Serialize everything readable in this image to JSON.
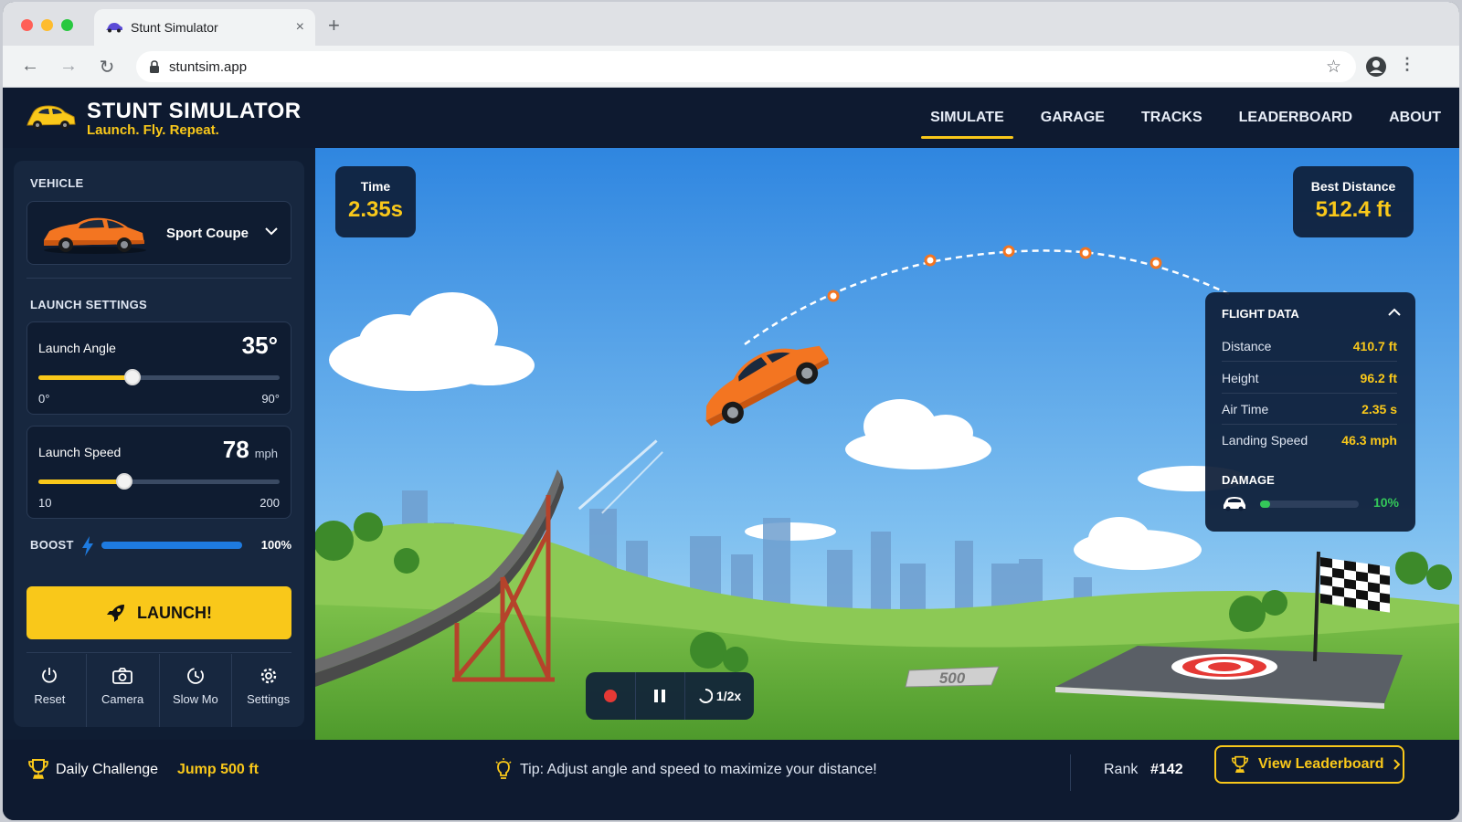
{
  "browser": {
    "tab_title": "Stunt Simulator",
    "tab_close": "×",
    "new_tab": "+",
    "url": "stuntsim.app"
  },
  "app": {
    "title": "STUNT SIMULATOR",
    "tagline": "Launch. Fly. Repeat.",
    "nav": [
      "SIMULATE",
      "GARAGE",
      "TRACKS",
      "LEADERBOARD",
      "ABOUT"
    ],
    "active_nav": "SIMULATE"
  },
  "sidebar": {
    "vehicle_label": "VEHICLE",
    "vehicle_name": "Sport Coupe",
    "launch_settings_label": "LAUNCH SETTINGS",
    "angle": {
      "label": "Launch Angle",
      "value": "35°",
      "min": "0°",
      "max": "90°",
      "fraction": 0.3889
    },
    "speed": {
      "label": "Launch Speed",
      "value": "78",
      "unit": "mph",
      "min": "10",
      "max": "200",
      "fraction": 0.3579
    },
    "boost": {
      "label": "BOOST",
      "value": "100%",
      "fraction": 1.0
    },
    "launch_button": "LAUNCH!",
    "tools": [
      "Reset",
      "Camera",
      "Slow Mo",
      "Settings"
    ]
  },
  "hud": {
    "time_label": "Time",
    "time_value": "2.35s",
    "best_label": "Best Distance",
    "best_value": "512.4 ft",
    "flight_title": "FLIGHT DATA",
    "flight_rows": [
      {
        "k": "Distance",
        "v": "410.7 ft"
      },
      {
        "k": "Height",
        "v": "96.2 ft"
      },
      {
        "k": "Air Time",
        "v": "2.35 s"
      },
      {
        "k": "Landing Speed",
        "v": "46.3 mph"
      }
    ],
    "damage_label": "DAMAGE",
    "damage_value": "10%",
    "damage_fraction": 0.1,
    "playback_speed": "1/2x",
    "distance_sign": "500"
  },
  "footer": {
    "challenge_label": "Daily Challenge",
    "challenge_goal": "Jump 500 ft",
    "tip": "Tip: Adjust angle and speed to maximize your distance!",
    "rank_label": "Rank",
    "rank_value": "#142",
    "leaderboard_button": "View Leaderboard"
  },
  "colors": {
    "accent": "#f9c81a",
    "panel": "#17273f",
    "header": "#0e1a30",
    "boost": "#1e7be0",
    "damage": "#34c759"
  }
}
